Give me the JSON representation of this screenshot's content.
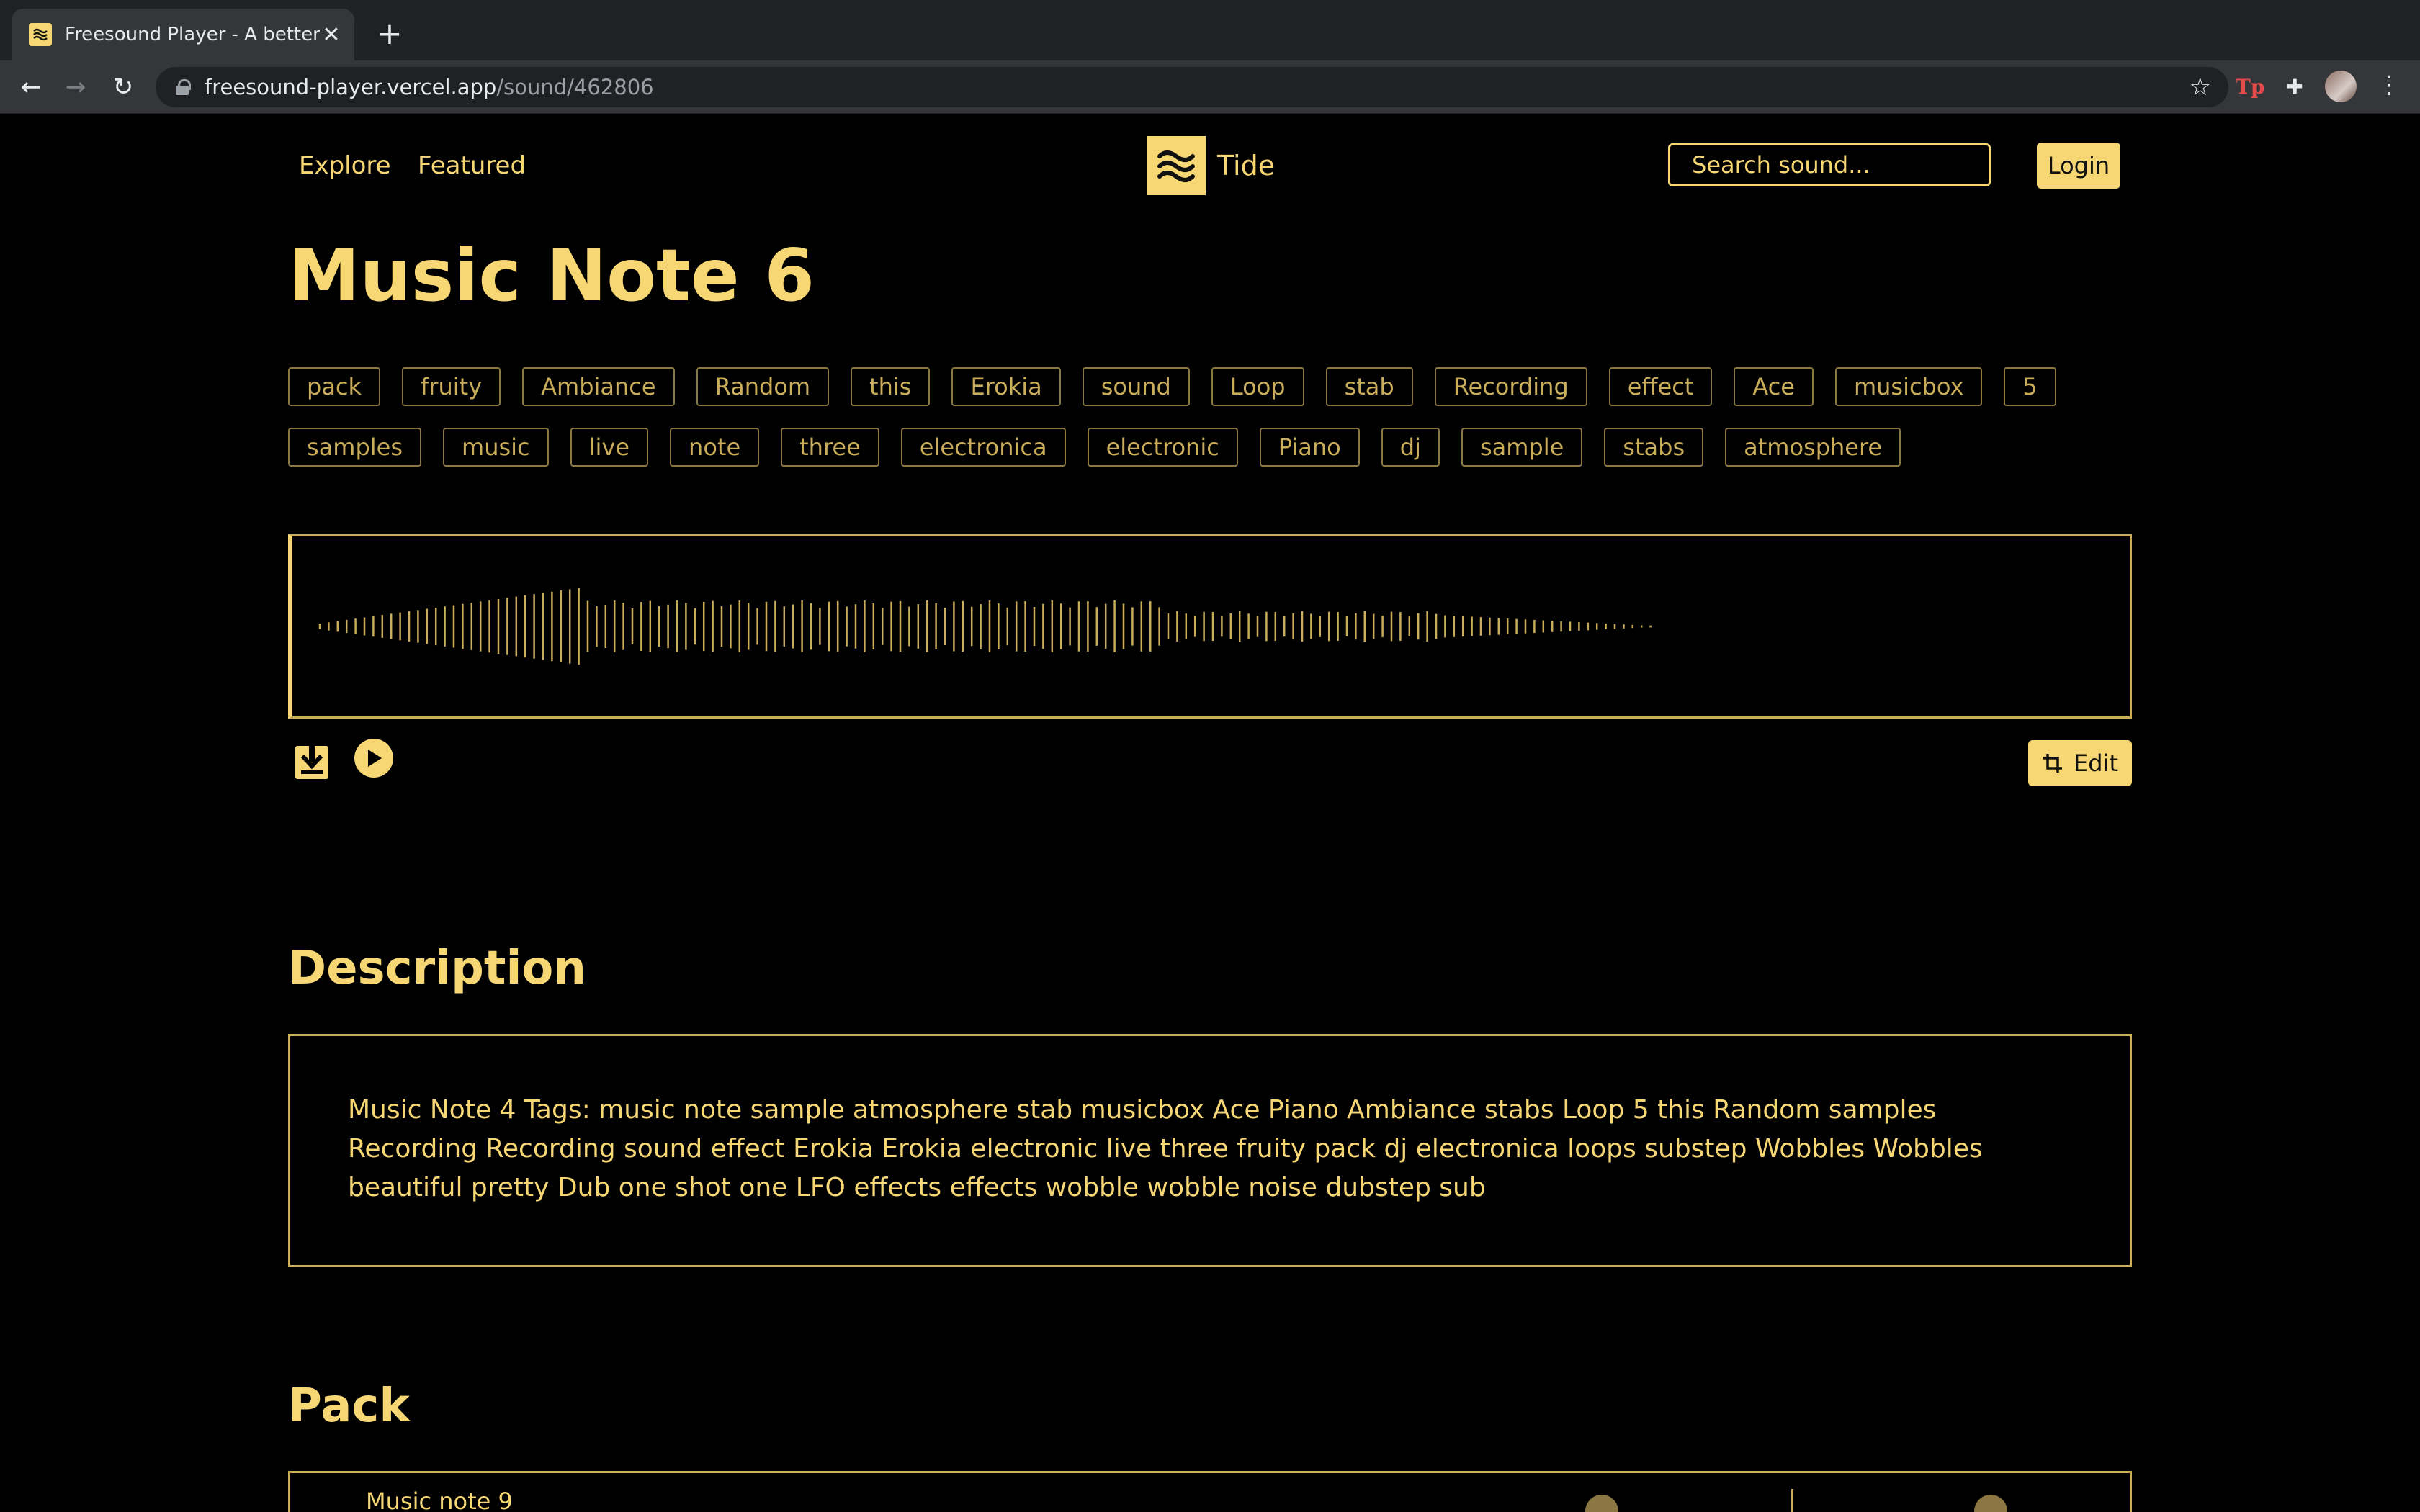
{
  "browser": {
    "tab_title": "Freesound Player - A better Freesound",
    "new_tab": "+",
    "url_host": "freesound-player.vercel.app",
    "url_path": "/sound/462806"
  },
  "nav": {
    "explore": "Explore",
    "featured": "Featured",
    "brand": "Tide",
    "search_placeholder": "Search sound...",
    "login": "Login"
  },
  "sound": {
    "title": "Music Note 6",
    "tags": [
      "pack",
      "fruity",
      "Ambiance",
      "Random",
      "this",
      "Erokia",
      "sound",
      "Loop",
      "stab",
      "Recording",
      "effect",
      "Ace",
      "musicbox",
      "5",
      "samples",
      "music",
      "live",
      "note",
      "three",
      "electronica",
      "electronic",
      "Piano",
      "dj",
      "sample",
      "stabs",
      "atmosphere"
    ],
    "edit_label": "Edit"
  },
  "description": {
    "heading": "Description",
    "text": "Music Note 4 Tags: music note sample atmosphere stab musicbox Ace Piano Ambiance stabs Loop 5 this Random samples Recording Recording sound effect Erokia Erokia electronic live three fruity pack dj electronica loops substep Wobbles Wobbles beautiful pretty Dub one shot one LFO effects effects wobble wobble noise dubstep sub"
  },
  "pack": {
    "heading": "Pack",
    "first_item": "Music note 9"
  },
  "colors": {
    "accent": "#f7d774",
    "muted": "#c9ad5a",
    "background": "#000000"
  }
}
